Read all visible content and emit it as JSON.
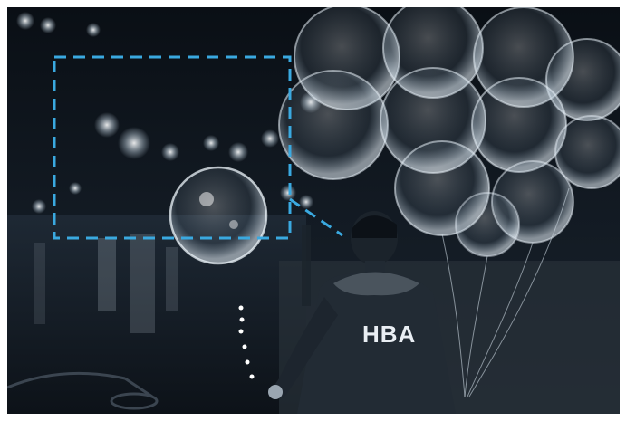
{
  "photo": {
    "jacket_text": "HBA",
    "accent_color": "#3aa9e0",
    "tone": "monochrome-blue"
  },
  "overlay": {
    "highlight_box": {
      "style": "dashed",
      "color": "#3aa9e0"
    }
  }
}
